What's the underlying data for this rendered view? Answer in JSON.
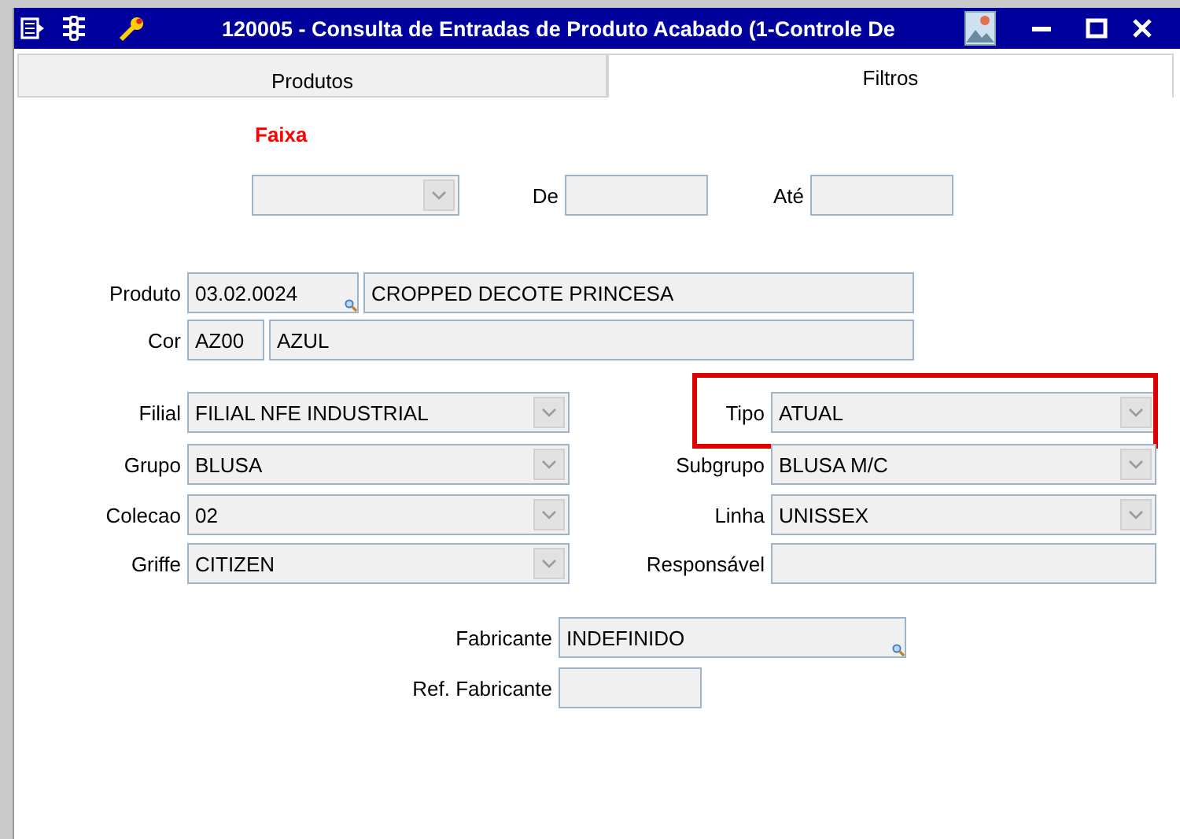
{
  "window": {
    "title": "120005 - Consulta de Entradas de Produto Acabado (1-Controle De"
  },
  "tabs": [
    {
      "label": "Produtos",
      "selected": false
    },
    {
      "label": "Filtros",
      "selected": true
    }
  ],
  "faixa": {
    "title": "Faixa",
    "from_label": "De",
    "to_label": "Até"
  },
  "product": {
    "label": "Produto",
    "code": "03.02.0024",
    "description": "CROPPED DECOTE PRINCESA"
  },
  "color": {
    "label": "Cor",
    "code": "AZ00",
    "description": "AZUL"
  },
  "left_fields": [
    {
      "label": "Filial",
      "value": "FILIAL NFE INDUSTRIAL",
      "kind": "combo"
    },
    {
      "label": "Grupo",
      "value": "BLUSA",
      "kind": "combo"
    },
    {
      "label": "Colecao",
      "value": "02",
      "kind": "combo"
    },
    {
      "label": "Griffe",
      "value": "CITIZEN",
      "kind": "combo"
    }
  ],
  "right_fields": [
    {
      "label": "Tipo",
      "value": "ATUAL",
      "kind": "combo",
      "highlighted": true
    },
    {
      "label": "Subgrupo",
      "value": "BLUSA M/C",
      "kind": "combo",
      "highlighted": false
    },
    {
      "label": "Linha",
      "value": "UNISSEX",
      "kind": "combo",
      "highlighted": false
    },
    {
      "label": "Responsável",
      "kind": "text",
      "highlighted": false
    }
  ],
  "manufacturer": {
    "label": "Fabricante",
    "value": "INDEFINIDO"
  },
  "manufacturer_ref": {
    "label": "Ref. Fabricante"
  }
}
